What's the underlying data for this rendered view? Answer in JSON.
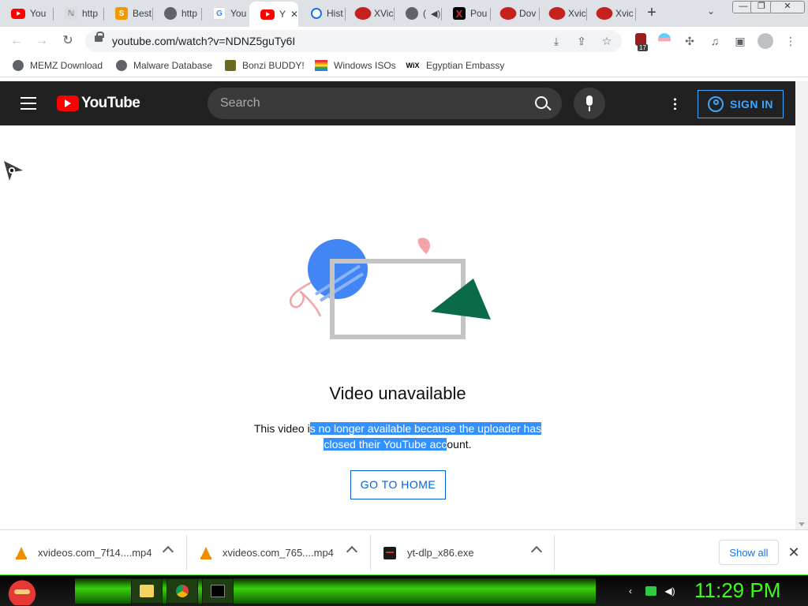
{
  "browser": {
    "tabs": [
      {
        "label": "You",
        "favicon": "youtube-icon",
        "active": false
      },
      {
        "label": "http",
        "favicon": "site-icon",
        "active": false
      },
      {
        "label": "Best",
        "favicon": "s-logo-icon",
        "active": false
      },
      {
        "label": "http",
        "favicon": "globe-icon",
        "active": false
      },
      {
        "label": "You",
        "favicon": "google-icon",
        "active": false
      },
      {
        "label": "Y",
        "favicon": "youtube-icon",
        "active": true,
        "close": "✕"
      },
      {
        "label": "Hist",
        "favicon": "history-icon",
        "active": false
      },
      {
        "label": "XVic",
        "favicon": "red-blot-icon",
        "active": false
      },
      {
        "label": "(",
        "favicon": "globe-icon",
        "active": false
      },
      {
        "label": "Pou",
        "favicon": "x-logo-icon",
        "active": false
      },
      {
        "label": "Dov",
        "favicon": "red-blot-icon",
        "active": false
      },
      {
        "label": "Xvic",
        "favicon": "red-blot-icon",
        "active": false
      },
      {
        "label": "Xvic",
        "favicon": "red-blot-icon",
        "active": false
      }
    ],
    "new_tab": "+",
    "url": "youtube.com/watch?v=NDNZ5guTy6I",
    "extension_badge": "17",
    "window_controls": {
      "minimize": "—",
      "maximize": "❐",
      "close": "✕"
    },
    "bookmarks": [
      {
        "label": "MEMZ Download",
        "icon": "globe-icon"
      },
      {
        "label": "Malware Database",
        "icon": "globe-icon"
      },
      {
        "label": "Bonzi BUDDY!",
        "icon": "bonzi-icon"
      },
      {
        "label": "Windows ISOs",
        "icon": "rainbow-flag-icon"
      },
      {
        "label": "Egyptian Embassy",
        "icon": "wix-icon",
        "icon_text": "WiX"
      }
    ]
  },
  "youtube": {
    "logo_text": "YouTube",
    "search_placeholder": "Search",
    "sign_in": "SIGN IN",
    "error": {
      "title": "Video unavailable",
      "message_plain_1": "This video i",
      "message_selected_1": "s no longer available because the uploader has ",
      "message_selected_2": "closed their YouTube acc",
      "message_plain_2": "ount.",
      "button": "GO TO HOME"
    }
  },
  "downloads": {
    "items": [
      {
        "name": "xvideos.com_7f14....mp4",
        "icon": "vlc-cone-icon"
      },
      {
        "name": "xvideos.com_765....mp4",
        "icon": "vlc-cone-icon"
      },
      {
        "name": "yt-dlp_x86.exe",
        "icon": "exe-icon"
      }
    ],
    "show_all": "Show all",
    "close": "✕"
  },
  "taskbar": {
    "clock": "11:29 PM",
    "accent": "#39ff14"
  },
  "colors": {
    "yt_header": "#212121",
    "yt_red": "#ff0000",
    "signin_blue": "#3ea6ff",
    "selection": "#3390ff",
    "go_home_blue": "#065fd4"
  }
}
